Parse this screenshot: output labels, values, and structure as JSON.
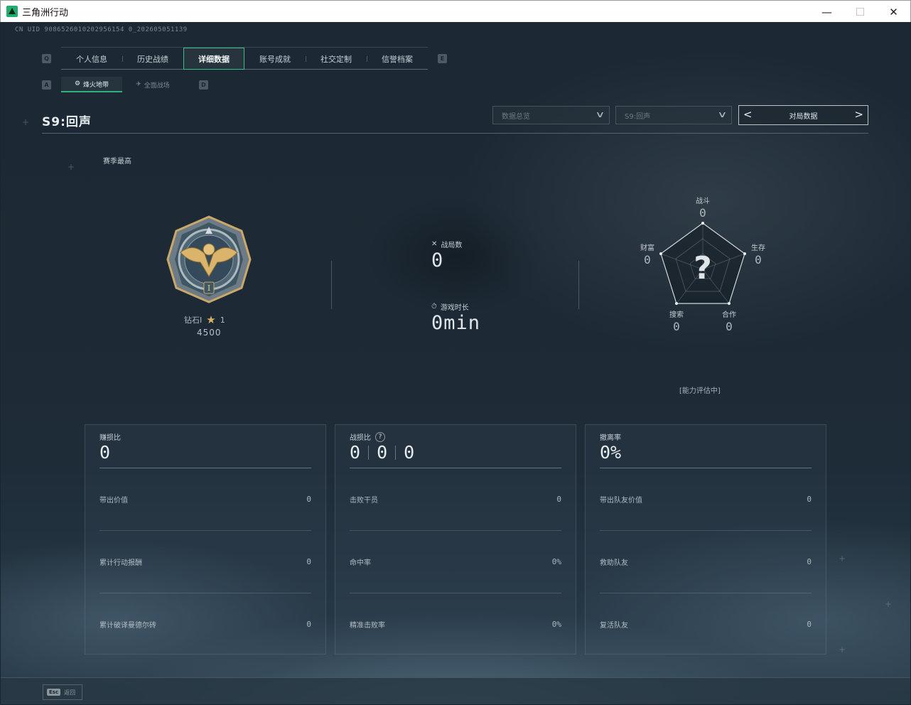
{
  "window": {
    "title": "三角洲行动"
  },
  "uid": "CN UID 9086526010202956154 0_202605051139",
  "main_tabs": {
    "left_key": "Q",
    "right_key": "E",
    "items": [
      {
        "label": "个人信息"
      },
      {
        "label": "历史战绩"
      },
      {
        "label": "详细数据",
        "active": true
      },
      {
        "label": "账号成就"
      },
      {
        "label": "社交定制"
      },
      {
        "label": "信誉档案"
      }
    ]
  },
  "sub_tabs": {
    "left_key": "A",
    "right_key": "D",
    "items": [
      {
        "label": "烽火地带",
        "icon": "flame-zone-icon",
        "active": true
      },
      {
        "label": "全面战场",
        "icon": "warfare-icon"
      }
    ]
  },
  "season": {
    "title": "S9:回声"
  },
  "filters": {
    "data_scope": "数据总览",
    "season": "S9:回声",
    "mode": "对局数据"
  },
  "rank": {
    "label": "赛季最高",
    "tier": "钻石I",
    "stars": "1",
    "score": "4500"
  },
  "summary": {
    "matches_label": "战局数",
    "matches": "0",
    "time_label": "游戏时长",
    "time": "0min"
  },
  "radar": {
    "center_mark": "?",
    "axes": [
      {
        "label": "战斗",
        "value": "0"
      },
      {
        "label": "生存",
        "value": "0"
      },
      {
        "label": "合作",
        "value": "0"
      },
      {
        "label": "搜索",
        "value": "0"
      },
      {
        "label": "财富",
        "value": "0"
      }
    ],
    "status": "[能力评估中]"
  },
  "panels": [
    {
      "title": "赚损比",
      "big": [
        "0"
      ],
      "rows": [
        {
          "label": "带出价值",
          "value": "0"
        },
        {
          "label": "累计行动报酬",
          "value": "0"
        },
        {
          "label": "累计破译曼德尔砖",
          "value": "0"
        }
      ]
    },
    {
      "title": "战损比",
      "help": "?",
      "big": [
        "0",
        "0",
        "0"
      ],
      "rows": [
        {
          "label": "击败干员",
          "value": "0"
        },
        {
          "label": "命中率",
          "value": "0%"
        },
        {
          "label": "精准击败率",
          "value": "0%"
        }
      ]
    },
    {
      "title": "撤离率",
      "big": [
        "0%"
      ],
      "rows": [
        {
          "label": "带出队友价值",
          "value": "0"
        },
        {
          "label": "救助队友",
          "value": "0"
        },
        {
          "label": "复活队友",
          "value": "0"
        }
      ]
    }
  ],
  "footer": {
    "esc_key": "Esc",
    "esc_label": "返回"
  }
}
